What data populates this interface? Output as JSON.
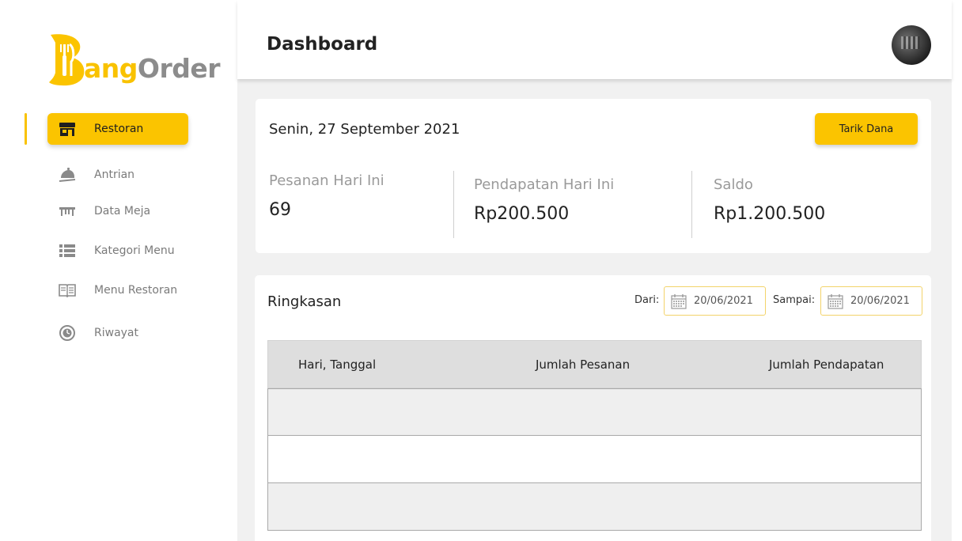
{
  "brand": {
    "wordmark_part1": "ang",
    "wordmark_part2": "Order",
    "primary_color": "#fbc400",
    "secondary_color": "#8c8c8c"
  },
  "sidebar": {
    "items": [
      {
        "label": "Restoran",
        "icon": "store-icon",
        "active": true
      },
      {
        "label": "Antrian",
        "icon": "cloche-icon",
        "active": false
      },
      {
        "label": "Data Meja",
        "icon": "table-icon",
        "active": false
      },
      {
        "label": "Kategori Menu",
        "icon": "list-icon",
        "active": false
      },
      {
        "label": "Menu Restoran",
        "icon": "book-icon",
        "active": false
      },
      {
        "label": "Riwayat",
        "icon": "history-icon",
        "active": false
      }
    ]
  },
  "header": {
    "title": "Dashboard",
    "avatar": "user-avatar"
  },
  "stats_card": {
    "date": "Senin, 27 September 2021",
    "withdraw_button": "Tarik Dana",
    "stats": [
      {
        "label": "Pesanan Hari Ini",
        "value": "69"
      },
      {
        "label": "Pendapatan Hari Ini",
        "value": "Rp200.500"
      },
      {
        "label": "Saldo",
        "value": "Rp1.200.500"
      }
    ]
  },
  "summary": {
    "title": "Ringkasan",
    "from_label": "Dari:",
    "from_value": "20/06/2021",
    "to_label": "Sampai:",
    "to_value": "20/06/2021",
    "columns": [
      "Hari, Tanggal",
      "Jumlah Pesanan",
      "Jumlah Pendapatan"
    ]
  }
}
